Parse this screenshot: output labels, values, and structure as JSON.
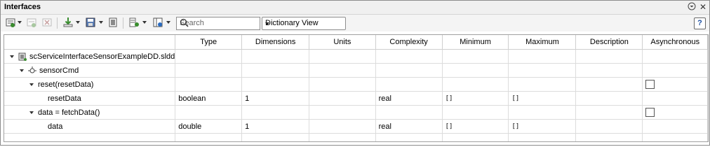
{
  "window": {
    "title": "Interfaces"
  },
  "toolbar": {
    "search_placeholder": "Search",
    "view_selected": "Dictionary View",
    "help_label": "?"
  },
  "table": {
    "columns": [
      "",
      "Type",
      "Dimensions",
      "Units",
      "Complexity",
      "Minimum",
      "Maximum",
      "Description",
      "Asynchronous"
    ],
    "rows": [
      {
        "name": "scServiceInterfaceSensorExampleDD.sldd",
        "type": "",
        "dimensions": "",
        "units": "",
        "complexity": "",
        "minimum": "",
        "maximum": "",
        "description": "",
        "async": ""
      },
      {
        "name": "sensorCmd",
        "type": "",
        "dimensions": "",
        "units": "",
        "complexity": "",
        "minimum": "",
        "maximum": "",
        "description": "",
        "async": ""
      },
      {
        "name": "reset(resetData)",
        "type": "",
        "dimensions": "",
        "units": "",
        "complexity": "",
        "minimum": "",
        "maximum": "",
        "description": "",
        "async": ""
      },
      {
        "name": "resetData",
        "type": "boolean",
        "dimensions": "1",
        "units": "",
        "complexity": "real",
        "minimum": "[]",
        "maximum": "[]",
        "description": "",
        "async": ""
      },
      {
        "name": "data = fetchData()",
        "type": "",
        "dimensions": "",
        "units": "",
        "complexity": "",
        "minimum": "",
        "maximum": "",
        "description": "",
        "async": ""
      },
      {
        "name": "data",
        "type": "double",
        "dimensions": "1",
        "units": "",
        "complexity": "real",
        "minimum": "[]",
        "maximum": "[]",
        "description": "",
        "async": ""
      }
    ]
  },
  "colors": {
    "accent_green": "#3a8d2f",
    "border": "#a0a0a0",
    "header_bg": "#f0f0f0"
  }
}
